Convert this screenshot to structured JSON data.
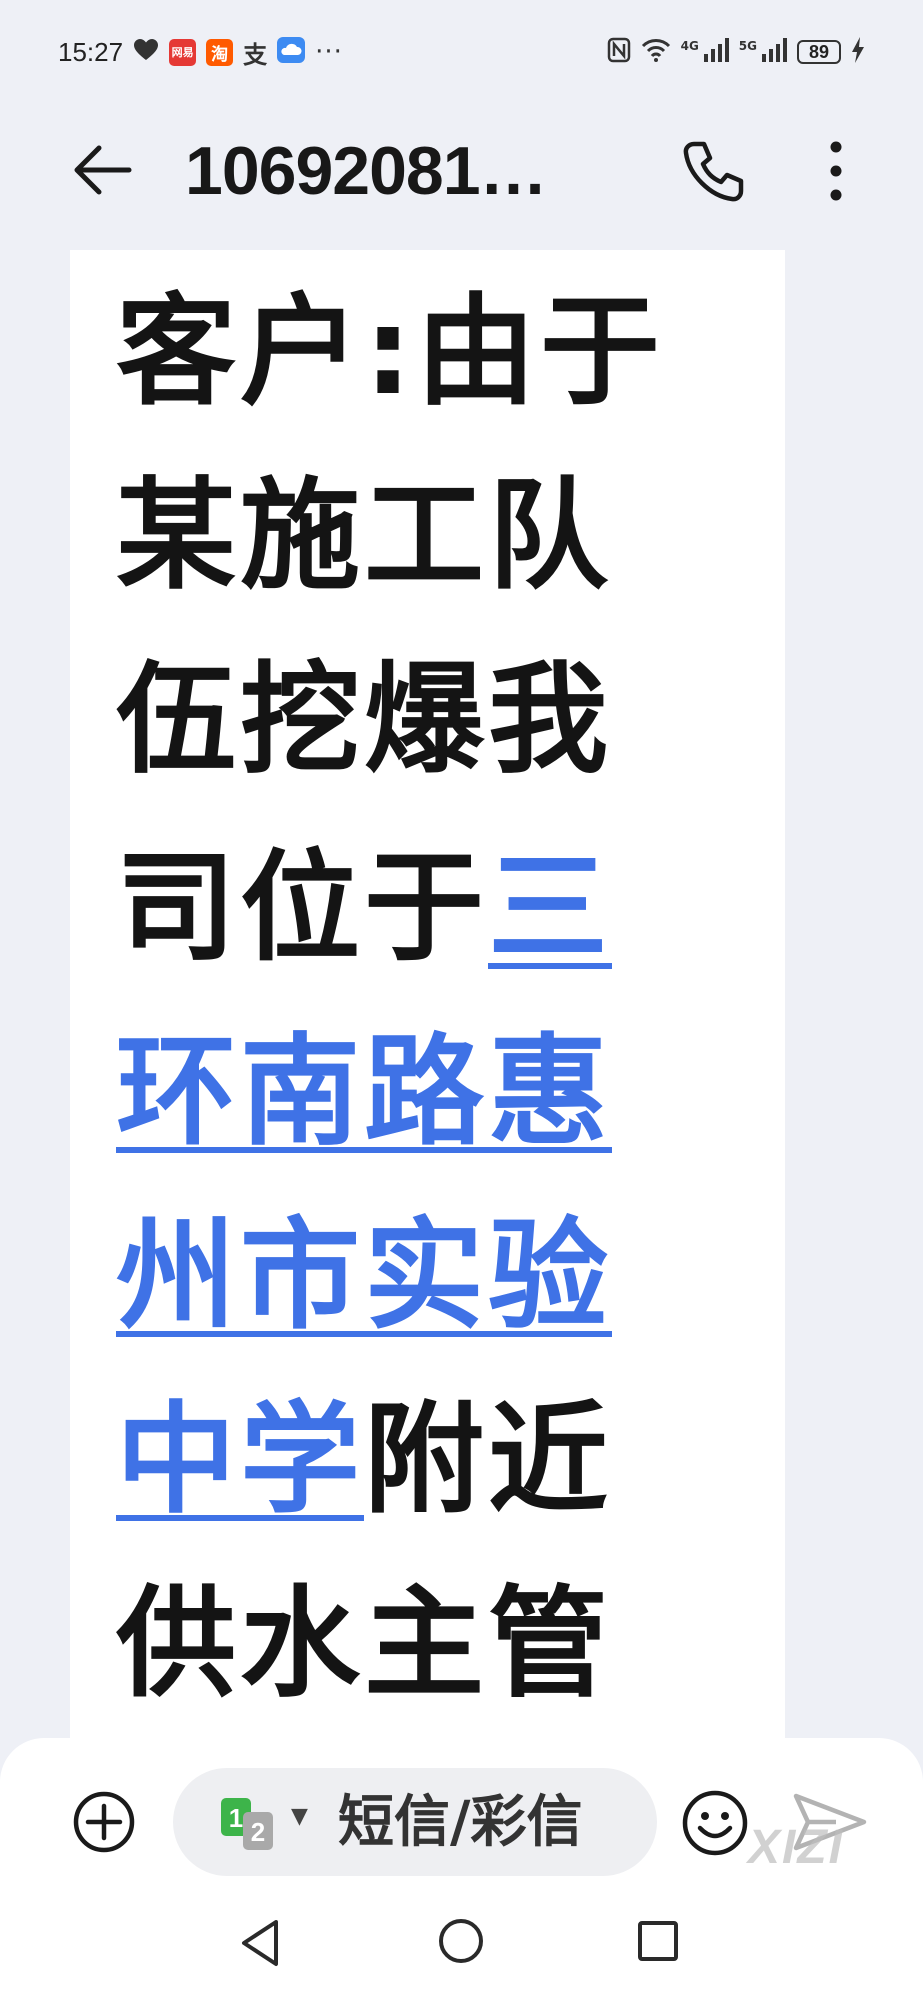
{
  "status_bar": {
    "time": "15:27",
    "apps": [
      {
        "icon": "netease-app-icon",
        "label": "网易",
        "color": "#e53935"
      },
      {
        "icon": "taobao-app-icon",
        "label": "淘",
        "color": "#ff5a00"
      }
    ],
    "alipay_glyph": "支",
    "more_dots": "···",
    "net1": "4G",
    "net2": "5G",
    "battery": "89"
  },
  "header": {
    "title": "10692081…",
    "icons": {
      "back": "back-arrow-icon",
      "call": "phone-icon",
      "more": "more-vertical-icon"
    }
  },
  "message": {
    "lines": [
      {
        "segments": [
          {
            "text": "客户:由于",
            "link": false
          }
        ]
      },
      {
        "segments": [
          {
            "text": "某施工队",
            "link": false
          }
        ]
      },
      {
        "segments": [
          {
            "text": "伍挖爆我",
            "link": false
          }
        ]
      },
      {
        "segments": [
          {
            "text": "司位于",
            "link": false
          },
          {
            "text": "三",
            "link": true
          }
        ]
      },
      {
        "segments": [
          {
            "text": "环南路惠",
            "link": true
          }
        ]
      },
      {
        "segments": [
          {
            "text": "州市实验",
            "link": true
          }
        ]
      },
      {
        "segments": [
          {
            "text": "中学",
            "link": true
          },
          {
            "text": "附近",
            "link": false
          }
        ]
      },
      {
        "segments": [
          {
            "text": "供水主管",
            "link": false
          }
        ]
      }
    ],
    "link_color": "#3f72e6"
  },
  "composer": {
    "placeholder": "短信/彩信",
    "watermark": "XIZI",
    "icons": {
      "add": "add-circle-icon",
      "sim": "dual-sim-icon",
      "emoji": "emoji-icon",
      "send": "send-icon"
    }
  },
  "nav": {
    "icons": [
      "nav-back-icon",
      "nav-home-icon",
      "nav-recent-icon"
    ]
  }
}
